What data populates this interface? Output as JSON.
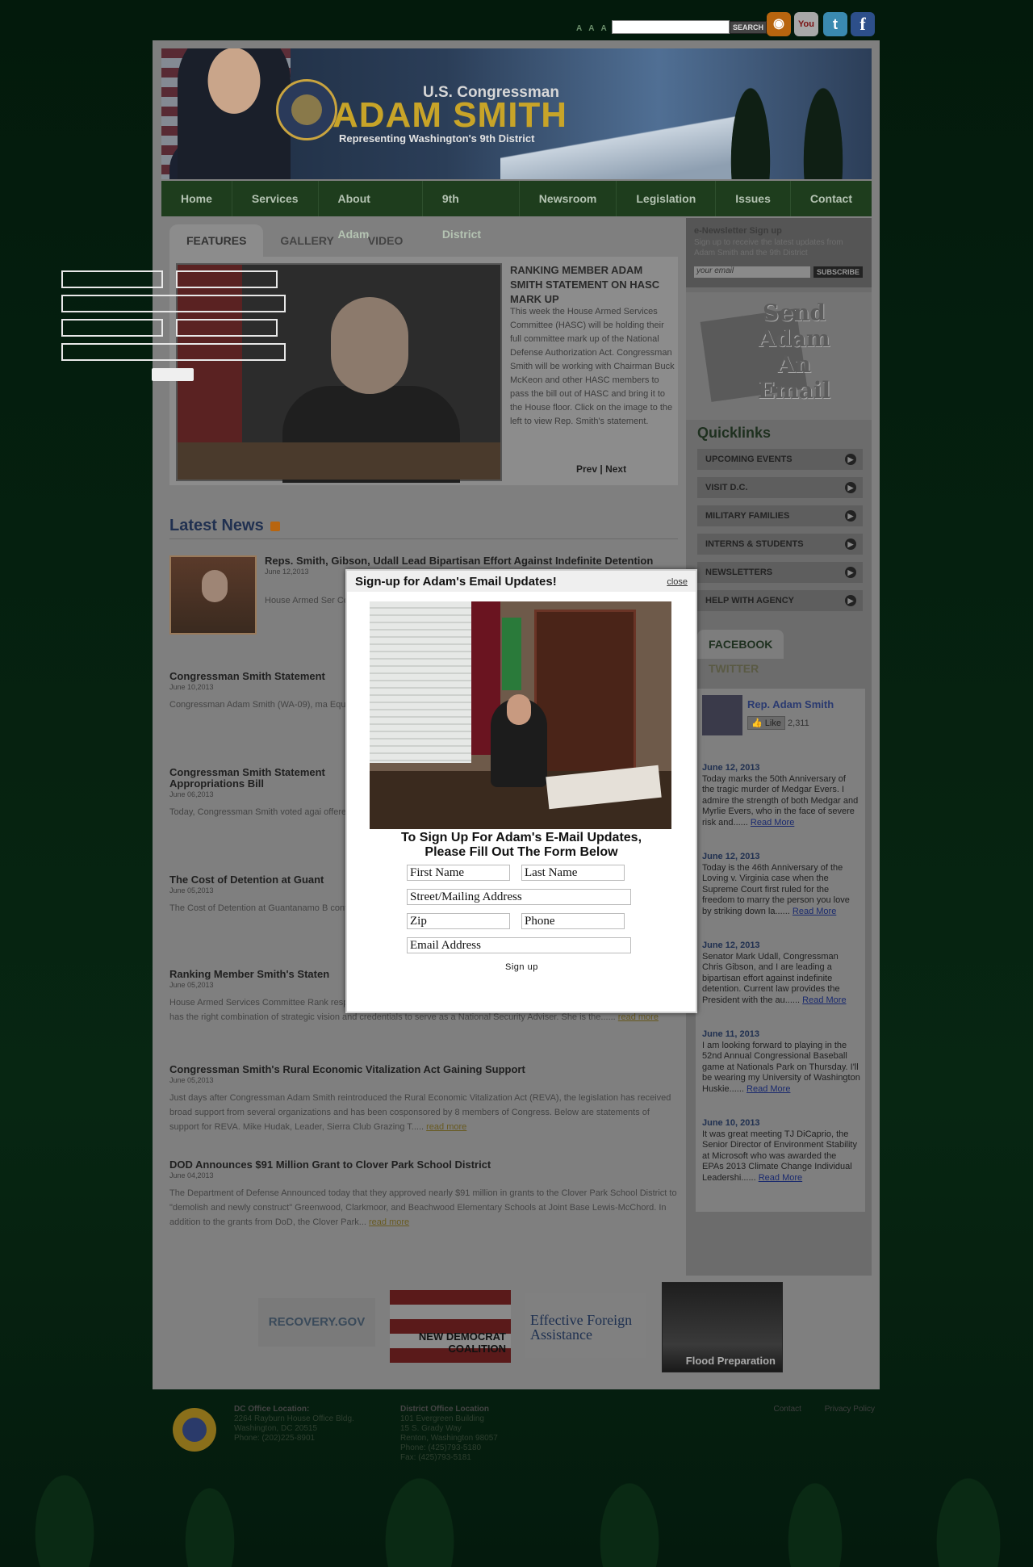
{
  "topbar": {
    "font_size_label": "A A A",
    "search_placeholder": "",
    "search_button": "SEARCH",
    "icons": [
      "rss-icon",
      "youtube-icon",
      "twitter-icon",
      "facebook-icon"
    ],
    "youtube_glyph": "You",
    "twitter_glyph": "t",
    "facebook_glyph": "f"
  },
  "banner": {
    "kicker": "U.S. Congressman",
    "name": "ADAM SMITH",
    "tagline": "Representing Washington's 9th District"
  },
  "nav": [
    "Home",
    "Services",
    "About Adam",
    "9th District",
    "Newsroom",
    "Legislation",
    "Issues",
    "Contact"
  ],
  "tabs": [
    "FEATURES",
    "GALLERY",
    "VIDEO"
  ],
  "feature": {
    "title": "RANKING MEMBER ADAM SMITH STATEMENT ON HASC MARK UP",
    "text": "This week the House Armed Services Committee (HASC) will be holding their full committee mark up of the National Defense Authorization Act. Congressman Smith will be working with Chairman Buck McKeon and other HASC members to pass the bill out of HASC and bring it to the House floor. Click on the image to the left to view Rep. Smith's statement.",
    "prev": "Prev",
    "sep": "|",
    "next": "Next"
  },
  "latest": {
    "heading": "Latest News",
    "items": [
      {
        "title": "Reps. Smith, Gibson, Udall Lead Bipartisan Effort Against Indefinite Detention",
        "date": "June 12,2013",
        "text": "House Armed Ser Congressman Ch Committee on Inte to ensure that any individual detained o"
      },
      {
        "title": "Congressman Smith Statement",
        "date": "June 10,2013",
        "text": "Congressman Adam Smith (WA-09), ma Equal Pay Act: \"With women making up nearly the same level as men, pay inequ"
      },
      {
        "title": "Congressman Smith Statement Appropriations Bill",
        "date": "June 06,2013",
        "text": "Today, Congressman Smith voted agai offered by Steve King (R-IA) that would continued implementation of the Obama"
      },
      {
        "title": "The Cost of Detention at Guant",
        "date": "June 05,2013",
        "text": "The Cost of Detention at Guantanamo B continuing to operate an expensive and Ranking Member Adam Smith authored"
      },
      {
        "title": "Ranking Member Smith's Staten",
        "date": "June 05,2013",
        "text": "House Armed Services Committee Rank response to Ambassador Rice's appointment as National Security Adviser: \"Susan Rice has the right combination of strategic vision and credentials to serve as a National Security Adviser. She is the......",
        "more": "read more"
      },
      {
        "title": "Congressman Smith's Rural Economic Vitalization Act Gaining Support",
        "date": "June 05,2013",
        "text": "Just days after Congressman Adam Smith reintroduced the Rural Economic Vitalization Act (REVA), the legislation has received broad support from several organizations and has been cosponsored by 8 members of Congress. Below are statements of support for REVA. Mike Hudak, Leader, Sierra Club Grazing T.....",
        "more": "read more"
      },
      {
        "title": "DOD Announces $91 Million Grant to Clover Park School District",
        "date": "June 04,2013",
        "text": "The Department of Defense Announced today that they approved nearly $91 million in grants to the Clover Park School District to \"demolish and newly construct\" Greenwood, Clarkmoor, and Beachwood Elementary Schools at Joint Base Lewis-McChord. In addition to the grants from DoD, the Clover Park...",
        "more": "read more"
      }
    ]
  },
  "newsletter": {
    "title": "e-Newsletter Sign up",
    "desc": "Sign up to receive the latest updates from Adam Smith and the 9th District",
    "placeholder": "your email",
    "button": "SUBSCRIBE"
  },
  "send_email": "Send Adam An Email",
  "quicklinks": {
    "heading": "Quicklinks",
    "items": [
      "UPCOMING EVENTS",
      "VISIT D.C.",
      "MILITARY FAMILIES",
      "INTERNS & STUDENTS",
      "NEWSLETTERS",
      "HELP WITH AGENCY"
    ]
  },
  "social": {
    "tabs": [
      "FACEBOOK",
      "TWITTER"
    ],
    "page_name": "Rep. Adam Smith",
    "like": "Like",
    "like_count": "2,311",
    "posts": [
      {
        "date": "June 12, 2013",
        "text": "Today marks the 50th Anniversary of the tragic murder of Medgar Evers. I admire the strength of both Medgar and Myrlie Evers, who in the face of severe risk and......",
        "more": "Read More"
      },
      {
        "date": "June 12, 2013",
        "text": "Today is the 46th Anniversary of the Loving v. Virginia case when the Supreme Court first ruled for the freedom to marry the person you love by striking down la......",
        "more": "Read More"
      },
      {
        "date": "June 12, 2013",
        "text": "Senator Mark Udall, Congressman Chris Gibson, and I are leading a bipartisan effort against indefinite detention. Current law provides the President with the au......",
        "more": "Read More"
      },
      {
        "date": "June 11, 2013",
        "text": "I am looking forward to playing in the 52nd Annual Congressional Baseball game at Nationals Park on Thursday. I'll be wearing my University of Washington Huskie......",
        "more": "Read More"
      },
      {
        "date": "June 10, 2013",
        "text": "It was great meeting TJ DiCaprio, the Senior Director of Environment Stability at Microsoft who was awarded the EPAs 2013 Climate Change Individual Leadershi......",
        "more": "Read More"
      }
    ]
  },
  "partners": {
    "recovery": "RECOVERY.GOV",
    "new_dem": "NEW DEMOCRAT COALITION",
    "effective": "Effective Foreign Assistance",
    "flood": "Flood Preparation"
  },
  "footer": {
    "dc_title": "DC Office Location:",
    "dc_lines": [
      "2264 Rayburn House Office Bldg.",
      "Washington, DC 20515",
      "Phone: (202)225-8901"
    ],
    "district_title": "District Office Location",
    "district_lines": [
      "101 Evergreen Building",
      "15 S. Grady Way",
      "Renton, Washington 98057",
      "Phone: (425)793-5180",
      "Fax: (425)793-5181"
    ],
    "links": [
      "Contact",
      "Privacy Policy"
    ]
  },
  "modal": {
    "title": "Sign-up for Adam's Email Updates!",
    "close": "close",
    "instructions_line1": "To Sign Up For Adam's E-Mail Updates,",
    "instructions_line2": "Please Fill Out The Form Below",
    "fields": {
      "first_name": "First Name",
      "last_name": "Last Name",
      "street": "Street/Mailing Address",
      "zip": "Zip",
      "phone": "Phone",
      "email": "Email Address"
    },
    "submit": "Sign up"
  }
}
